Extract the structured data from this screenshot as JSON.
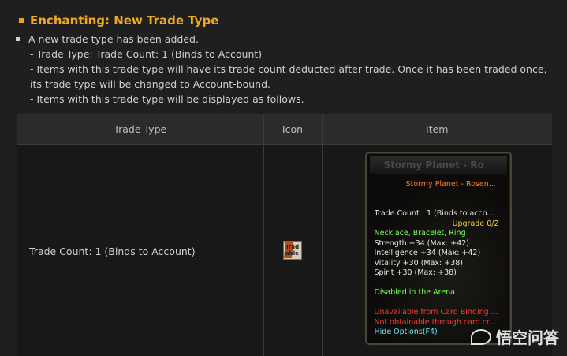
{
  "section": {
    "title": "Enchanting: New Trade Type",
    "intro": "A new trade type has been added.",
    "details": [
      "- Trade Type: Trade Count: 1 (Binds to Account)",
      "- Items with this trade type will have its trade count deducted after trade. Once it has been traded once, its trade type will be changed to Account-bound.",
      "- Items with this trade type will be displayed as follows."
    ]
  },
  "table": {
    "headers": [
      "Trade Type",
      "Icon",
      "Item"
    ],
    "row": {
      "trade_type": "Trade Count: 1 (Binds to Account)",
      "icon_text": "Trad able",
      "icon_name": "tradable-icon"
    }
  },
  "tooltip": {
    "name_bar": "Stormy Planet - Ro",
    "item_name": "Stormy Planet - Rosen...",
    "trade_count": "Trade Count : 1 (Binds to acco...",
    "upgrade": "Upgrade 0/2",
    "slots": "Necklace, Bracelet, Ring",
    "stats": [
      "Strength +34 (Max: +42)",
      "Intelligence +34 (Max: +42)",
      "Vitality +30 (Max: +38)",
      "Spirit +30 (Max: +38)"
    ],
    "arena": "Disabled in the Arena",
    "card_binding": "Unavailable from Card Binding ...",
    "card_crafting": "Not obtainable through card cr...",
    "hide_options": "Hide Options(F4)"
  },
  "watermark": {
    "text": "悟空问答"
  },
  "colors": {
    "heading": "#f0a820",
    "background": "#1f1f1f"
  }
}
